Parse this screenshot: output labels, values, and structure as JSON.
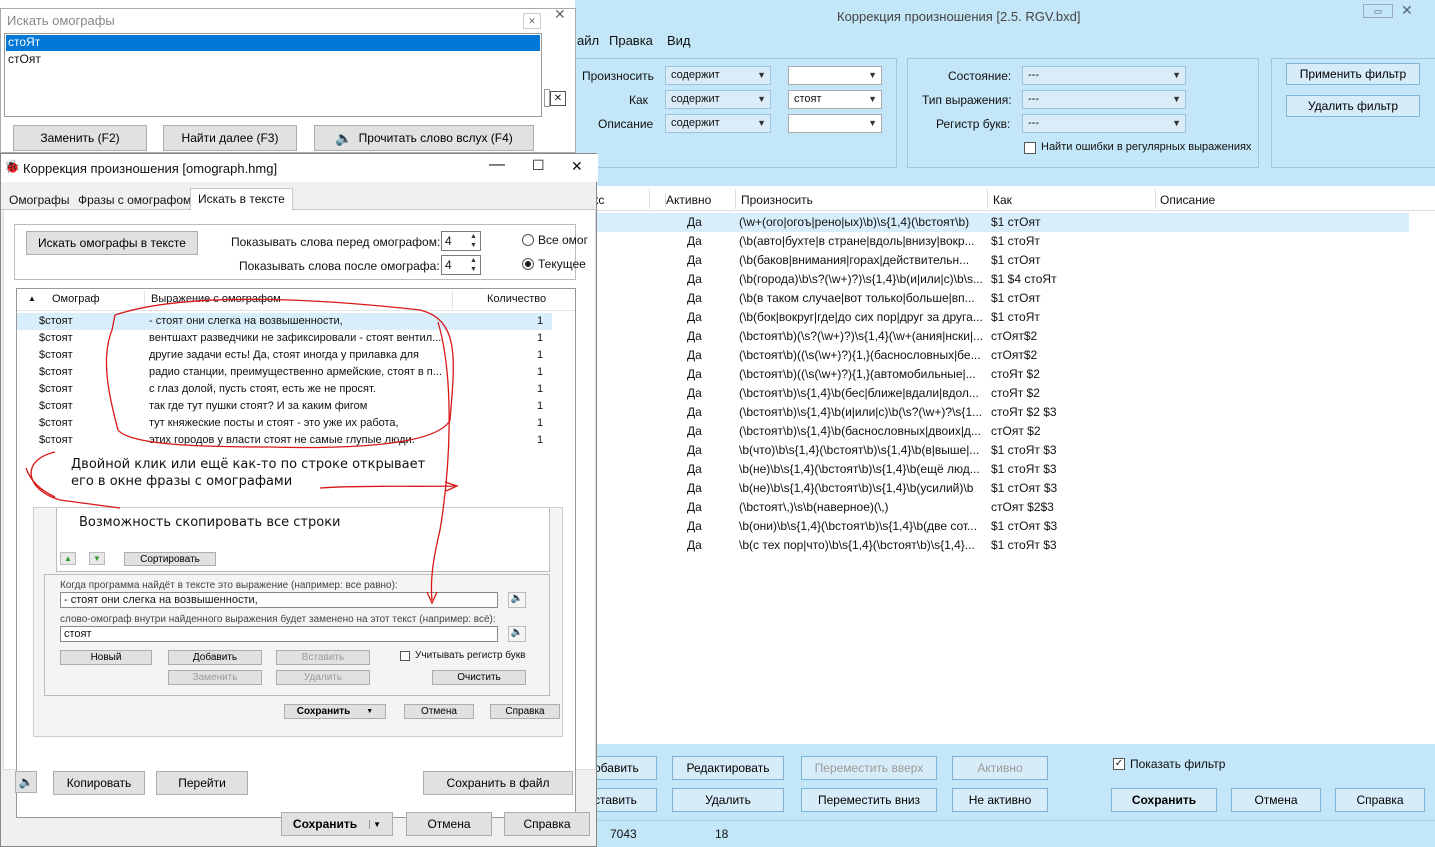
{
  "main": {
    "title": "Коррекция произношения [2.5. RGV.bxd]",
    "menu": [
      "айл",
      "Правка",
      "Вид"
    ],
    "filter": {
      "pronounce_label": "Произносить",
      "how_label": "Как",
      "desc_label": "Описание",
      "pronounce_mode": "содержит",
      "how_mode": "содержит",
      "desc_mode": "содержит",
      "how_value": "стоят",
      "state_label": "Состояние:",
      "expr_type_label": "Тип выражения:",
      "case_label": "Регистр букв:",
      "state_value": "---",
      "expr_type_value": "---",
      "case_value": "---",
      "find_errors_label": "Найти ошибки в регулярных выражениях",
      "apply_button": "Применить фильтр",
      "remove_button": "Удалить фильтр"
    },
    "table": {
      "headers": [
        "кс",
        "Активно",
        "Произносить",
        "Как",
        "Описание"
      ],
      "rows": [
        [
          "Да",
          "(\\w+(ого|огоъ|рено|ых)\\b)\\s{1,4}(\\bстоят\\b)",
          "$1 стОят"
        ],
        [
          "Да",
          "(\\b(авто|бухте|в стране|вдоль|внизу|вокр...",
          "$1 стоЯт"
        ],
        [
          "Да",
          "(\\b(баков|внимания|горах|действительн...",
          "$1 стОят"
        ],
        [
          "Да",
          "(\\b(города)\\b\\s?(\\w+)?)\\s{1,4}\\b(и|или|с)\\b\\s...",
          "$1 $4 стоЯт"
        ],
        [
          "Да",
          "(\\b(в таком случае|вот только|больше|вп...",
          "$1 стОят"
        ],
        [
          "Да",
          "(\\b(бок|вокруг|где|до сих пор|друг за друга...",
          "$1 стоЯт"
        ],
        [
          "Да",
          "(\\bстоят\\b)(\\s?(\\w+)?)\\s{1,4}(\\w+(ания|нски|...",
          "стОят$2"
        ],
        [
          "Да",
          "(\\bстоят\\b)((\\s(\\w+)?){1,}(баснословных|бе...",
          "стОят$2"
        ],
        [
          "Да",
          "(\\bстоят\\b)((\\s(\\w+)?){1,}(автомобильные|...",
          "стоЯт $2"
        ],
        [
          "Да",
          "(\\bстоят\\b)\\s{1,4}\\b(бес|ближе|вдали|вдол...",
          "стоЯт $2"
        ],
        [
          "Да",
          "(\\bстоят\\b)\\s{1,4}\\b(и|или|с)\\b(\\s?(\\w+)?\\s{1...",
          "стоЯт $2 $3"
        ],
        [
          "Да",
          "(\\bстоят\\b)\\s{1,4}\\b(баснословных|двоих|д...",
          "стОят $2"
        ],
        [
          "Да",
          "\\b(что)\\b\\s{1,4}(\\bстоят\\b)\\s{1,4}\\b(в|выше|...",
          "$1 стоЯт $3"
        ],
        [
          "Да",
          "\\b(не)\\b\\s{1,4}(\\bстоят\\b)\\s{1,4}\\b(ещё люд...",
          "$1 стоЯт $3"
        ],
        [
          "Да",
          "\\b(не)\\b\\s{1,4}(\\bстоят\\b)\\s{1,4}\\b(усилий)\\b",
          "$1 стОят $3"
        ],
        [
          "Да",
          "(\\bстоят\\,)\\s\\b(наверное)(\\,)",
          "стОят $2$3"
        ],
        [
          "Да",
          "\\b(они)\\b\\s{1,4}(\\bстоят\\b)\\s{1,4}\\b(две сот...",
          "$1 стОят $3"
        ],
        [
          "Да",
          "\\b(с тех пор|что)\\b\\s{1,4}(\\bстоят\\b)\\s{1,4}...",
          "$1 стоЯт $3"
        ]
      ]
    },
    "buttons": {
      "add": "обавить",
      "edit": "Редактировать",
      "move_up": "Переместить вверх",
      "active": "Активно",
      "insert": "ставить",
      "delete": "Удалить",
      "move_down": "Переместить вниз",
      "inactive": "Не активно",
      "show_filter": "Показать фильтр",
      "save": "Сохранить",
      "cancel": "Отмена",
      "help": "Справка"
    },
    "status": {
      "count": "7043",
      "filtered": "18"
    }
  },
  "search_window": {
    "title": "Искать омографы",
    "items": [
      "стоЯт",
      "стОят"
    ],
    "replace_button": "Заменить (F2)",
    "find_next_button": "Найти далее (F3)",
    "read_aloud_button": "Прочитать слово вслух (F4)"
  },
  "omograph_window": {
    "title": "Коррекция произношения [omograph.hmg]",
    "tabs": [
      "Омографы",
      "Фразы с омографом",
      "Искать в тексте"
    ],
    "search_button": "Искать омографы в тексте",
    "before_label": "Показывать слова перед омографом:",
    "after_label": "Показывать слова после омографа:",
    "before_value": "4",
    "after_value": "4",
    "radio_all": "Все омог",
    "radio_current": "Текущее",
    "headers": [
      "Омограф",
      "Выражение с омографом",
      "Количество"
    ],
    "rows": [
      [
        "$стоят",
        "- стоят они слегка на возвышенности,",
        "1"
      ],
      [
        "$стоят",
        "вентшахт разведчики не зафиксировали - стоят вентил...",
        "1"
      ],
      [
        "$стоят",
        "другие задачи есть! Да, стоят иногда у прилавка для",
        "1"
      ],
      [
        "$стоят",
        "радио станции, преимущественно армейские, стоят в п...",
        "1"
      ],
      [
        "$стоят",
        "с глаз долой, пусть стоят, есть же не просят.",
        "1"
      ],
      [
        "$стоят",
        "так где тут пушки стоят? И за каким фигом",
        "1"
      ],
      [
        "$стоят",
        "тут княжеские посты и стоят - это уже их работа,",
        "1"
      ],
      [
        "$стоят",
        "этих городов у власти стоят не самые глупые люди.",
        "1"
      ]
    ],
    "annotation_1a": "Двойной клик или ещё как-то по строке открывает",
    "annotation_1b": "его в окне фразы с омографами",
    "annotation_2": "Возможность скопировать все строки",
    "mock": {
      "sort_button": "Сортировать",
      "when_label": "Когда программа найдёт в тексте это выражение (например: все равно):",
      "expr_value": "- стоят они слегка на возвышенности,",
      "replace_label": "слово-омограф внутри найденного выражения будет заменено на этот текст (например: всё):",
      "replace_value": "стоят",
      "new_button": "Новый",
      "add_button": "Добавить",
      "insert_button": "Вставить",
      "case_checkbox": "Учитывать регистр букв",
      "change_button": "Заменить",
      "delete_button": "Удалить",
      "clear_button": "Очистить",
      "save_button": "Сохранить",
      "cancel_button": "Отмена",
      "help_button": "Справка"
    },
    "copy_button": "Копировать",
    "goto_button": "Перейти",
    "save_file_button": "Сохранить в файл",
    "save_button": "Сохранить",
    "cancel_button": "Отмена",
    "help_button": "Справка"
  }
}
